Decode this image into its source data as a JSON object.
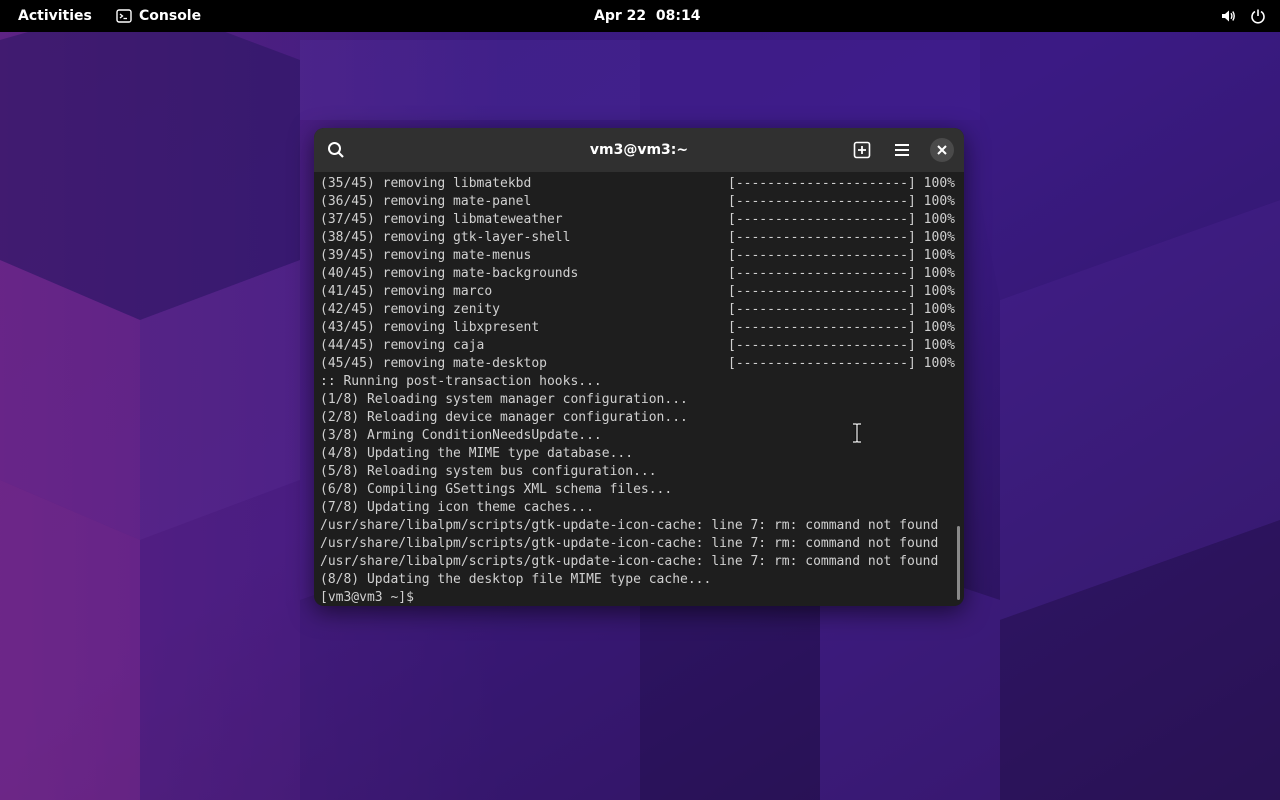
{
  "topbar": {
    "activities": "Activities",
    "app_name": "Console",
    "clock": "Apr 22  08:14",
    "icons": [
      "volume-icon",
      "power-icon"
    ]
  },
  "window": {
    "title": "vm3@vm3:~",
    "icons": [
      "search-icon",
      "new-tab-icon",
      "menu-icon",
      "close-icon"
    ]
  },
  "terminal": {
    "removals": [
      {
        "text": "(35/45) removing libmatekbd",
        "bar": "[----------------------] 100%"
      },
      {
        "text": "(36/45) removing mate-panel",
        "bar": "[----------------------] 100%"
      },
      {
        "text": "(37/45) removing libmateweather",
        "bar": "[----------------------] 100%"
      },
      {
        "text": "(38/45) removing gtk-layer-shell",
        "bar": "[----------------------] 100%"
      },
      {
        "text": "(39/45) removing mate-menus",
        "bar": "[----------------------] 100%"
      },
      {
        "text": "(40/45) removing mate-backgrounds",
        "bar": "[----------------------] 100%"
      },
      {
        "text": "(41/45) removing marco",
        "bar": "[----------------------] 100%"
      },
      {
        "text": "(42/45) removing zenity",
        "bar": "[----------------------] 100%"
      },
      {
        "text": "(43/45) removing libxpresent",
        "bar": "[----------------------] 100%"
      },
      {
        "text": "(44/45) removing caja",
        "bar": "[----------------------] 100%"
      },
      {
        "text": "(45/45) removing mate-desktop",
        "bar": "[----------------------] 100%"
      }
    ],
    "lines": [
      ":: Running post-transaction hooks...",
      "(1/8) Reloading system manager configuration...",
      "(2/8) Reloading device manager configuration...",
      "(3/8) Arming ConditionNeedsUpdate...",
      "(4/8) Updating the MIME type database...",
      "(5/8) Reloading system bus configuration...",
      "(6/8) Compiling GSettings XML schema files...",
      "(7/8) Updating icon theme caches...",
      "/usr/share/libalpm/scripts/gtk-update-icon-cache: line 7: rm: command not found",
      "/usr/share/libalpm/scripts/gtk-update-icon-cache: line 7: rm: command not found",
      "/usr/share/libalpm/scripts/gtk-update-icon-cache: line 7: rm: command not found",
      "(8/8) Updating the desktop file MIME type cache...",
      "[vm3@vm3 ~]$"
    ]
  },
  "colors": {
    "topbar_bg": "#000000",
    "window_bg": "#1e1e1e",
    "headerbar_bg": "#303030",
    "terminal_text": "#d0d0d0"
  }
}
